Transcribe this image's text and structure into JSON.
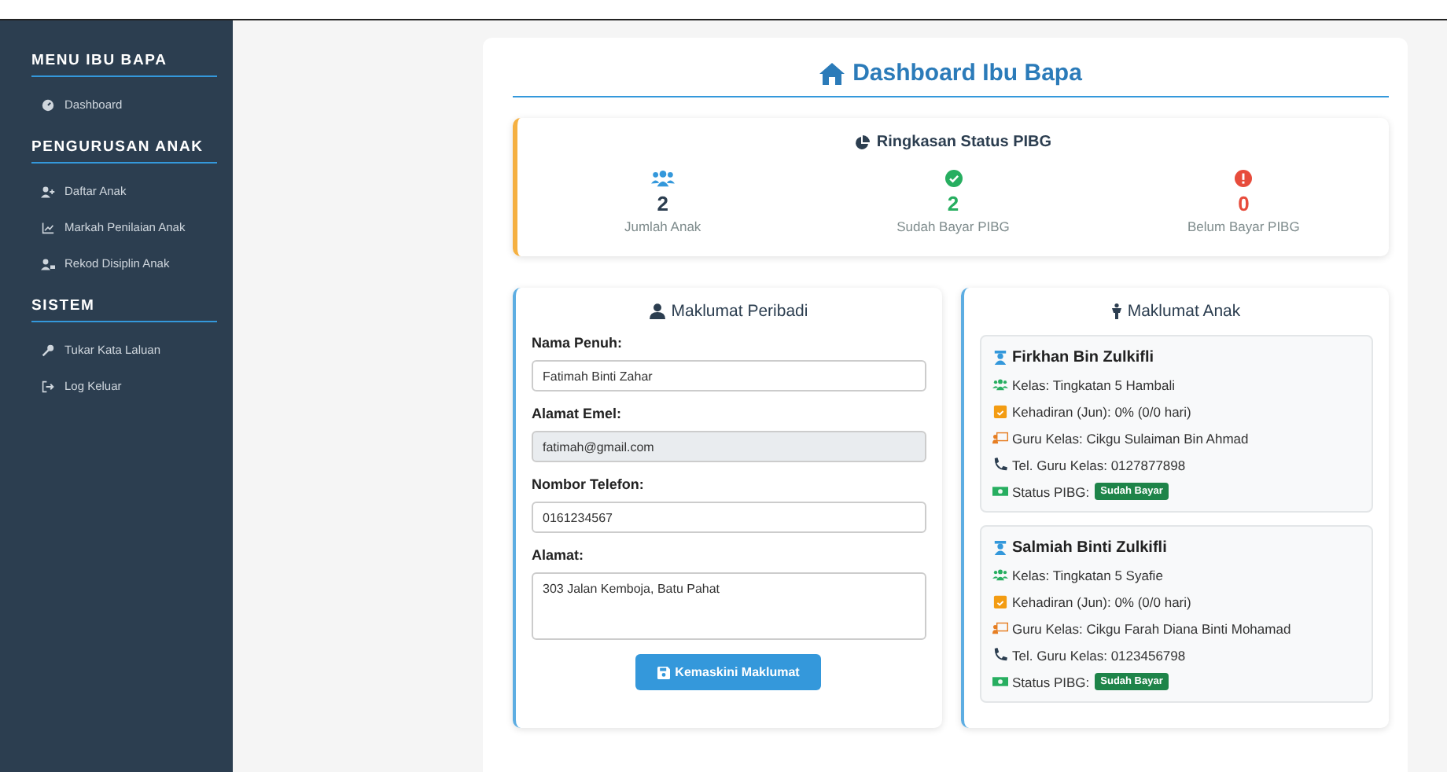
{
  "sidebar": {
    "sections": [
      {
        "title": "MENU IBU BAPA",
        "items": [
          {
            "label": "Dashboard"
          }
        ]
      },
      {
        "title": "PENGURUSAN ANAK",
        "items": [
          {
            "label": "Daftar Anak"
          },
          {
            "label": "Markah Penilaian Anak"
          },
          {
            "label": "Rekod Disiplin Anak"
          }
        ]
      },
      {
        "title": "SISTEM",
        "items": [
          {
            "label": "Tukar Kata Laluan"
          },
          {
            "label": "Log Keluar"
          }
        ]
      }
    ]
  },
  "page_title": "Dashboard Ibu Bapa",
  "summary": {
    "title": "Ringkasan Status PIBG",
    "stats": [
      {
        "kind": "total",
        "value": "2",
        "label": "Jumlah Anak"
      },
      {
        "kind": "paid",
        "value": "2",
        "label": "Sudah Bayar PIBG"
      },
      {
        "kind": "unpaid",
        "value": "0",
        "label": "Belum Bayar PIBG"
      }
    ]
  },
  "personal": {
    "title": "Maklumat Peribadi",
    "fields": [
      {
        "kind": "input",
        "label": "Nama Penuh:",
        "value": "Fatimah Binti Zahar",
        "disabled": false
      },
      {
        "kind": "input",
        "label": "Alamat Emel:",
        "value": "fatimah@gmail.com",
        "disabled": true
      },
      {
        "kind": "input",
        "label": "Nombor Telefon:",
        "value": "0161234567",
        "disabled": false
      },
      {
        "kind": "textarea",
        "label": "Alamat:",
        "value": "303 Jalan Kemboja, Batu Pahat",
        "disabled": false
      }
    ],
    "button": "Kemaskini Maklumat"
  },
  "children": {
    "title": "Maklumat Anak",
    "items": [
      {
        "name": "Firkhan Bin Zulkifli",
        "class": "Kelas: Tingkatan 5 Hambali",
        "attendance": "Kehadiran (Jun): 0% (0/0 hari)",
        "teacher": "Guru Kelas: Cikgu Sulaiman Bin Ahmad",
        "phone": "Tel. Guru Kelas: 0127877898",
        "status_label": "Status PIBG:",
        "status": "Sudah Bayar"
      },
      {
        "name": "Salmiah Binti Zulkifli",
        "class": "Kelas: Tingkatan 5 Syafie",
        "attendance": "Kehadiran (Jun): 0% (0/0 hari)",
        "teacher": "Guru Kelas: Cikgu Farah Diana Binti Mohamad",
        "phone": "Tel. Guru Kelas: 0123456798",
        "status_label": "Status PIBG:",
        "status": "Sudah Bayar"
      }
    ]
  }
}
